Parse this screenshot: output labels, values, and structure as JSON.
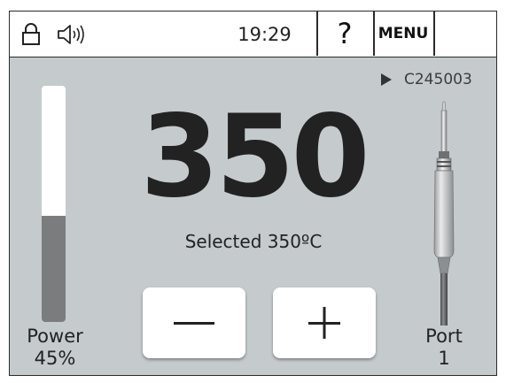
{
  "status_bar": {
    "time": "19:29",
    "help_label": "?",
    "menu_label": "MENU",
    "lock_icon": "lock-icon",
    "sound_icon": "speaker-icon"
  },
  "power": {
    "label": "Power",
    "value": "45%",
    "level_percent": 45
  },
  "temperature": {
    "value": "350",
    "selected_text": "Selected 350ºC"
  },
  "controls": {
    "minus_icon": "minus-icon",
    "plus_icon": "plus-icon"
  },
  "tool": {
    "code": "C245003",
    "port_label": "Port",
    "port_number": "1"
  },
  "colors": {
    "panel_background": "#c5cacd",
    "power_fill": "#7a7c7d",
    "text": "#222222"
  }
}
